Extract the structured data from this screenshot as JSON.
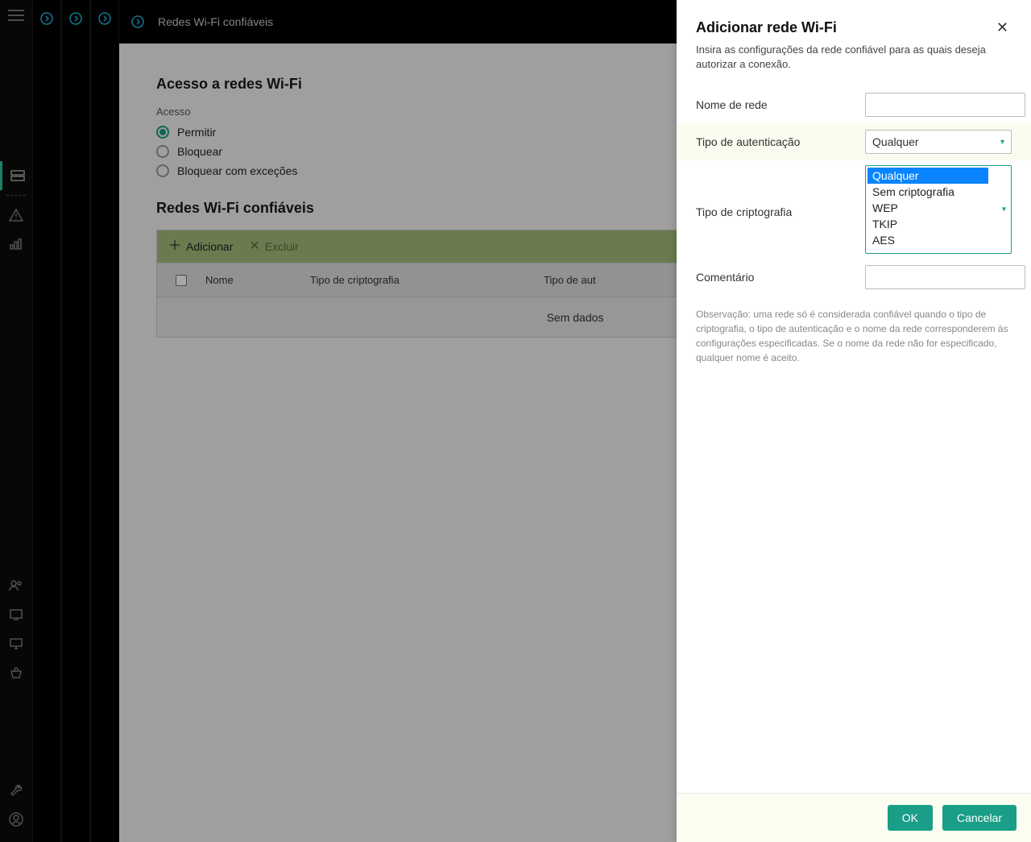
{
  "header": {
    "title": "Redes Wi-Fi confiáveis"
  },
  "main": {
    "section_access_title": "Acesso a redes Wi-Fi",
    "access_label": "Acesso",
    "radio": {
      "allow": "Permitir",
      "block": "Bloquear",
      "block_except": "Bloquear com exceções"
    },
    "section_trusted_title": "Redes Wi-Fi confiáveis",
    "toolbar": {
      "add": "Adicionar",
      "delete": "Excluir"
    },
    "columns": {
      "name": "Nome",
      "crypto": "Tipo de criptografia",
      "auth": "Tipo de aut"
    },
    "empty": "Sem dados"
  },
  "panel": {
    "title": "Adicionar rede Wi-Fi",
    "subtitle": "Insira as configurações da rede confiável para as quais deseja autorizar a conexão.",
    "net_name_label": "Nome de rede",
    "auth_type_label": "Tipo de autenticação",
    "auth_type_value": "Qualquer",
    "crypto_type_label": "Tipo de criptografia",
    "crypto_options": [
      "Qualquer",
      "Sem criptografia",
      "WEP",
      "TKIP",
      "AES"
    ],
    "comment_label": "Comentário",
    "note": "Observação: uma rede só é considerada confiável quando o tipo de criptografia, o tipo de autenticação e o nome da rede corresponderem às configurações especificadas. Se o nome da rede não for especificado, qualquer nome é aceito.",
    "ok": "OK",
    "cancel": "Cancelar"
  }
}
